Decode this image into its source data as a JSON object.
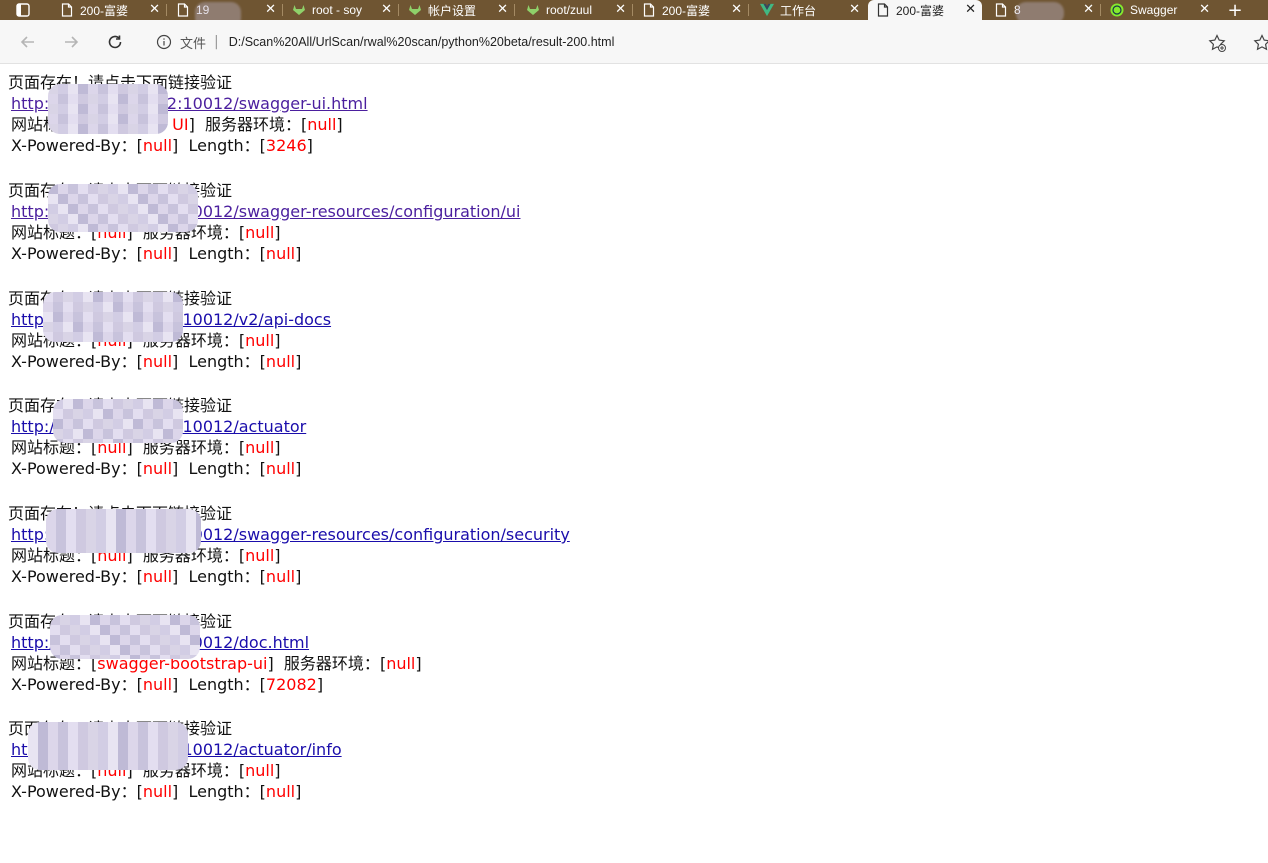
{
  "browser": {
    "tabs": [
      {
        "title": "200-富婆"
      },
      {
        "title": "19"
      },
      {
        "title": "root - soy"
      },
      {
        "title": "帐户设置"
      },
      {
        "title": "root/zuul"
      },
      {
        "title": "200-富婆"
      },
      {
        "title": "工作台"
      },
      {
        "title": "200-富婆"
      },
      {
        "title": "8"
      },
      {
        "title": "Swagger"
      }
    ],
    "tab_close": "✕",
    "new_tab": "+",
    "address_label": "文件",
    "address_separator": "|",
    "url": "D:/Scan%20All/UrlScan/rwal%20scan/python%20beta/result-200.html"
  },
  "colors": {
    "tab_strip": "#6f5532",
    "link": "#1a0dab",
    "visited_link": "#4b1f9e",
    "highlight": "#ff0000"
  },
  "labels": {
    "title_key": "网站标题：",
    "server_key": "服务器环境：",
    "powered_key": "X-Powered-By：",
    "length_key": "Length：",
    "open_bracket": "[",
    "close_bracket": "]"
  },
  "entries": [
    {
      "heading": "页面存在！请点击下面链接验证",
      "link": "http://192.168.1.102:10012/swagger-ui.html",
      "title": "Swagger UI",
      "server": "null",
      "powered_by": "null",
      "length": "3246"
    },
    {
      "heading": "页面存在！请点击下面链接验证",
      "link": "http://192.168.1.102:10012/swagger-resources/configuration/ui",
      "title": "null",
      "server": "null",
      "powered_by": "null",
      "length": "null"
    },
    {
      "heading": "页面存在！请点击下面链接验证",
      "link": "http://192.168.1.102:10012/v2/api-docs",
      "title": "null",
      "server": "null",
      "powered_by": "null",
      "length": "null"
    },
    {
      "heading": "页面存在！请点击下面链接验证",
      "link": "http://192.168.1.102:10012/actuator",
      "title": "null",
      "server": "null",
      "powered_by": "null",
      "length": "null"
    },
    {
      "heading": "页面存在！请点击下面链接验证",
      "link": "http://192.168.1.102:10012/swagger-resources/configuration/security",
      "title": "null",
      "server": "null",
      "powered_by": "null",
      "length": "null"
    },
    {
      "heading": "页面存在！请点击下面链接验证",
      "link": "http://192.168.1.102:10012/doc.html",
      "title": "swagger-bootstrap-ui",
      "server": "null",
      "powered_by": "null",
      "length": "72082"
    },
    {
      "heading": "页面存在！请点击下面链接验证",
      "link": "http://192.168.1.102:10012/actuator/info",
      "title": "null",
      "server": "null",
      "powered_by": "null",
      "length": "null"
    }
  ]
}
